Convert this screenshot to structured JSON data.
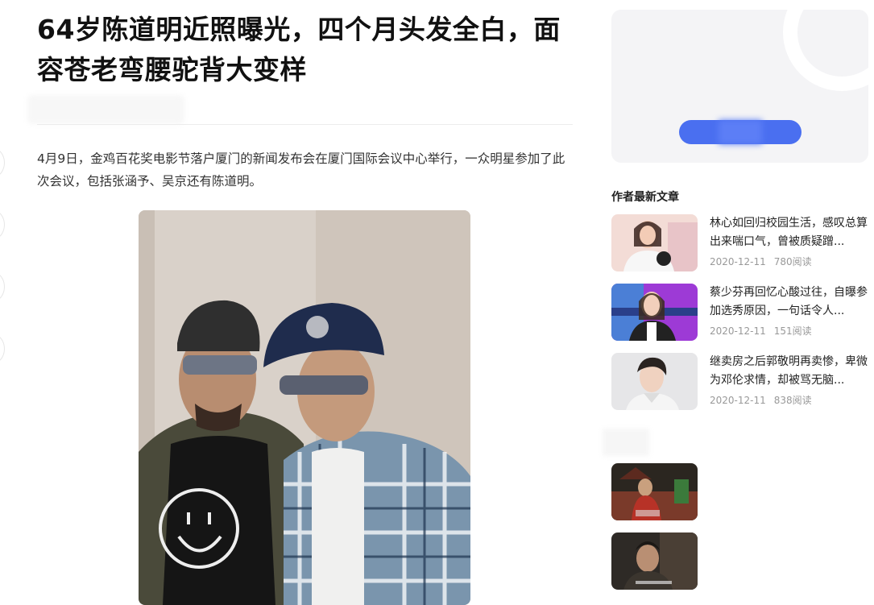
{
  "article": {
    "title": "64岁陈道明近照曝光，四个月头发全白，面容苍老弯腰驼背大变样",
    "paragraph": "4月9日，金鸡百花奖电影节落户厦门的新闻发布会在厦门国际会议中心举行，一众明星参加了此次会议，包括张涵予、吴京还有陈道明。",
    "image_icon": "photo-two-men-caps-sunglasses"
  },
  "sidebar": {
    "section_title": "作者最新文章",
    "accent_color": "#4a6ff0",
    "articles": [
      {
        "title": "林心如回归校园生活，感叹总算出来喘口气，曾被质疑蹭...",
        "date": "2020-12-11",
        "reads": "780阅读"
      },
      {
        "title": "蔡少芬再回忆心酸过往，自曝参加选秀原因，一句话令人...",
        "date": "2020-12-11",
        "reads": "151阅读"
      },
      {
        "title": "继卖房之后郭敬明再卖惨，卑微为邓伦求情，却被骂无脑...",
        "date": "2020-12-11",
        "reads": "838阅读"
      }
    ],
    "video_thumbs": [
      "period-drama-thumb",
      "period-drama-thumb-2"
    ]
  }
}
